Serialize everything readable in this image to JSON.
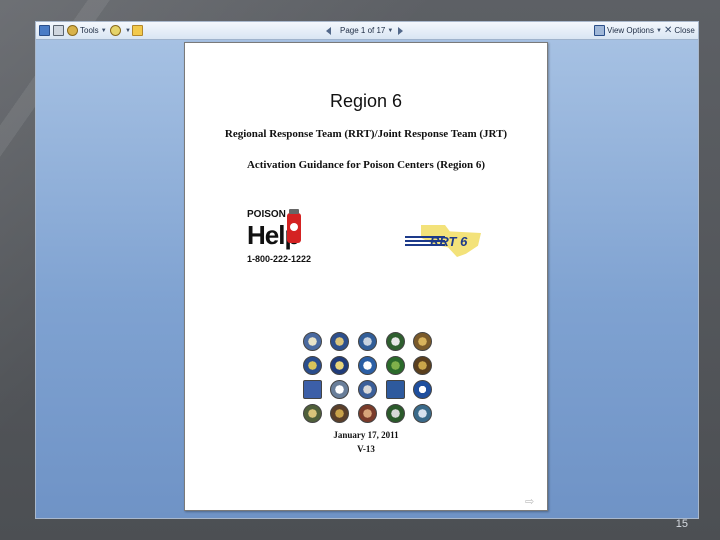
{
  "toolbar": {
    "tools_label": "Tools",
    "page_indicator": "Page 1 of 17",
    "view_options_label": "View Options",
    "close_label": "Close"
  },
  "document": {
    "region_heading": "Region 6",
    "title": "Regional Response Team (RRT)/Joint Response Team (JRT)",
    "subtitle": "Activation Guidance for Poison Centers (Region 6)",
    "poison_help": {
      "word_top": "POISON",
      "word_main": "Help",
      "phone": "1-800-222-1222"
    },
    "rrt_logo_text": "RRT 6",
    "date": "January 17, 2011",
    "version": "V-13"
  },
  "slide_number": "15",
  "colors": {
    "content_bg_top": "#a6c1e3",
    "content_bg_bottom": "#6f93c6",
    "poison_red": "#d42222",
    "rrt_blue": "#1d3a8a",
    "rrt_yellow": "#f3e27a"
  }
}
